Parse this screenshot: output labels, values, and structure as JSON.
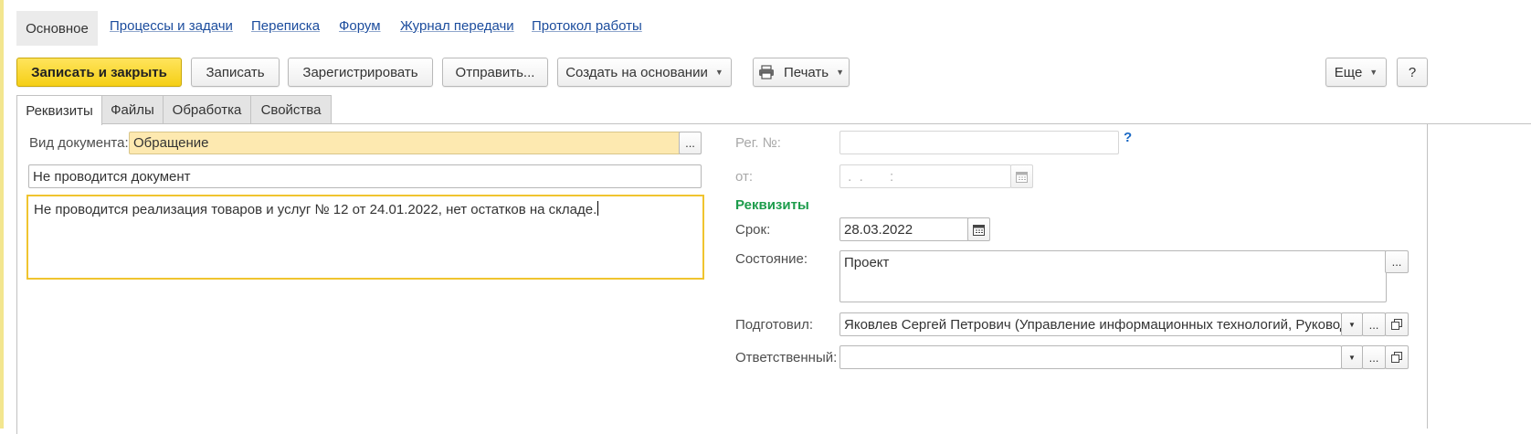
{
  "nav": {
    "home_label": "Основное",
    "links": [
      "Процессы и задачи",
      "Переписка",
      "Форум",
      "Журнал передачи",
      "Протокол работы"
    ]
  },
  "toolbar": {
    "save_close": "Записать и закрыть",
    "save": "Записать",
    "register": "Зарегистрировать",
    "send": "Отправить...",
    "create_based_on": "Создать на основании",
    "print": "Печать",
    "more": "Еще",
    "help": "?"
  },
  "tabs": [
    "Реквизиты",
    "Файлы",
    "Обработка",
    "Свойства"
  ],
  "form": {
    "doc_type_label": "Вид документа:",
    "doc_type_value": "Обращение",
    "title_value": "Не проводится документ",
    "body_value": "Не проводится реализация товаров и услуг № 12 от 24.01.2022,  нет остатков на складе.",
    "reg_no_label": "Рег. №:",
    "reg_no_value": "",
    "reg_help": "?",
    "from_label": "от:",
    "from_value": " .  .       :",
    "section_title": "Реквизиты",
    "deadline_label": "Срок:",
    "deadline_value": "28.03.2022",
    "state_label": "Состояние:",
    "state_value": "Проект",
    "prepared_label": "Подготовил:",
    "prepared_value": "Яковлев Сергей Петрович (Управление информационных технологий, Руководи",
    "responsible_label": "Ответственный:",
    "responsible_value": "",
    "ellipsis": "..."
  },
  "colors": {
    "primary_button": "#f5cf16",
    "highlight_field": "#fde9b0",
    "link": "#1b4c9d",
    "section_title": "#1c9c4b",
    "focus_border": "#f0c42f"
  }
}
